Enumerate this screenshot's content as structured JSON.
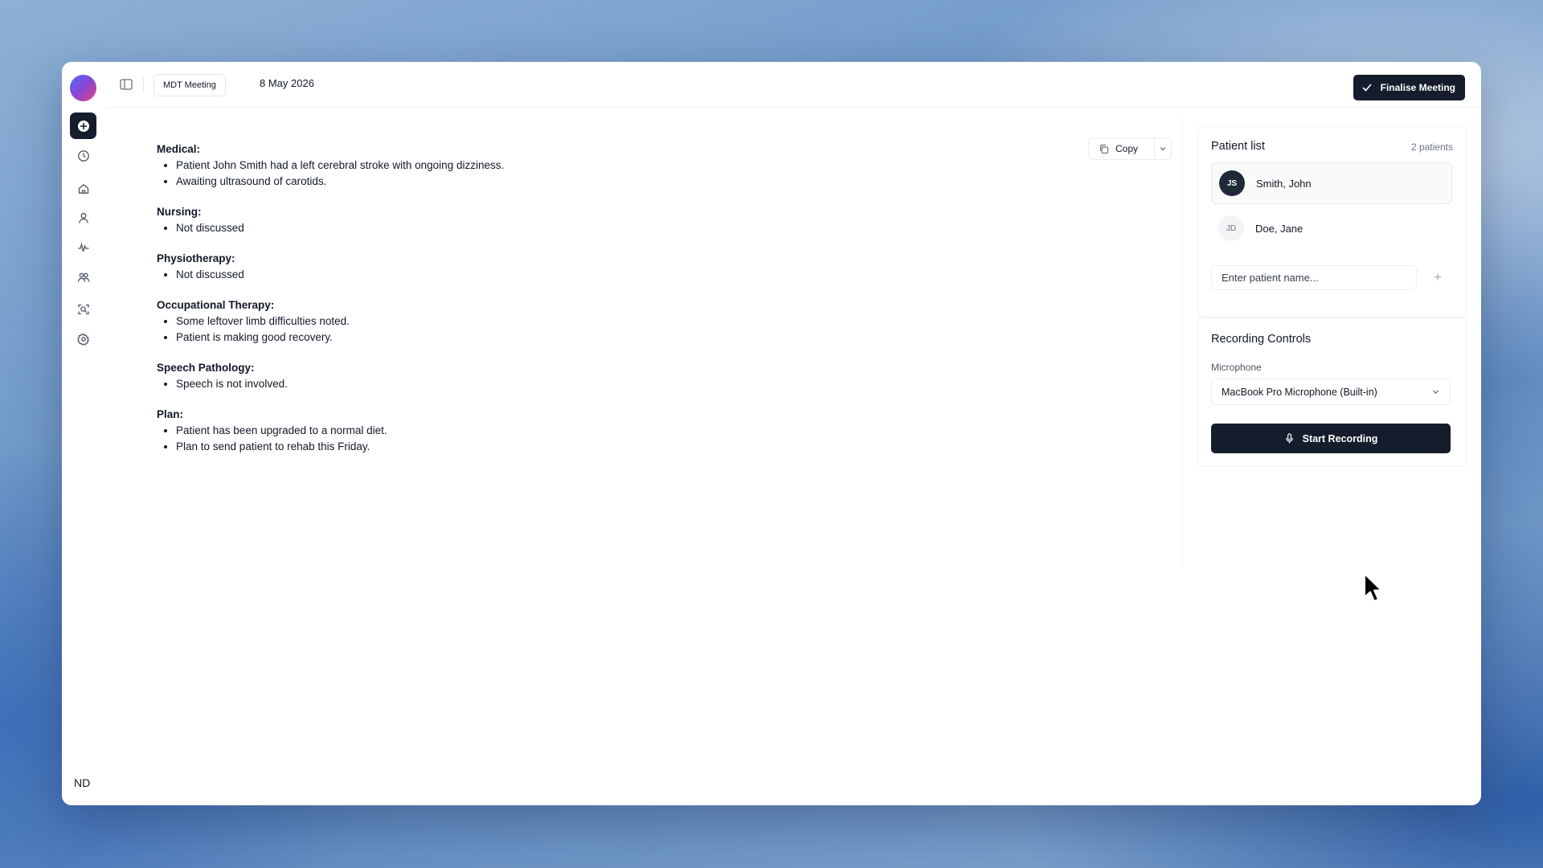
{
  "header": {
    "meeting_tag": "MDT Meeting",
    "date": "8 May 2026",
    "finalise_label": "Finalise Meeting"
  },
  "sidebar": {
    "items": [
      {
        "icon": "plus-icon",
        "active": true
      },
      {
        "icon": "clock-icon"
      },
      {
        "icon": "home-icon"
      },
      {
        "icon": "user-icon"
      },
      {
        "icon": "activity-icon"
      },
      {
        "icon": "users-icon"
      },
      {
        "icon": "search-document-icon"
      },
      {
        "icon": "gear-icon"
      }
    ],
    "user_initials": "ND"
  },
  "toolbar": {
    "copy_label": "Copy"
  },
  "notes": {
    "sections": [
      {
        "title": "Medical:",
        "items": [
          "Patient John Smith had a left cerebral stroke with ongoing dizziness.",
          "Awaiting ultrasound of carotids."
        ]
      },
      {
        "title": "Nursing:",
        "items": [
          "Not discussed"
        ]
      },
      {
        "title": "Physiotherapy:",
        "items": [
          "Not discussed"
        ]
      },
      {
        "title": "Occupational Therapy:",
        "items": [
          "Some leftover limb difficulties noted.",
          "Patient is making good recovery."
        ]
      },
      {
        "title": "Speech Pathology:",
        "items": [
          "Speech is not involved."
        ]
      },
      {
        "title": "Plan:",
        "items": [
          "Patient has been upgraded to a normal diet.",
          "Plan to send patient to rehab this Friday."
        ]
      }
    ]
  },
  "patient_list": {
    "title": "Patient list",
    "count": "2 patients",
    "patients": [
      {
        "initials": "JS",
        "name": "Smith, John",
        "selected": true
      },
      {
        "initials": "JD",
        "name": "Doe, Jane",
        "selected": false
      }
    ],
    "input_placeholder": "Enter patient name...",
    "add_label": "+"
  },
  "recording": {
    "title": "Recording Controls",
    "mic_label": "Microphone",
    "mic_value": "MacBook Pro Microphone (Built-in)",
    "start_label": "Start Recording"
  },
  "colors": {
    "primary_dark": "#151c2c",
    "border": "#e5e7eb"
  }
}
